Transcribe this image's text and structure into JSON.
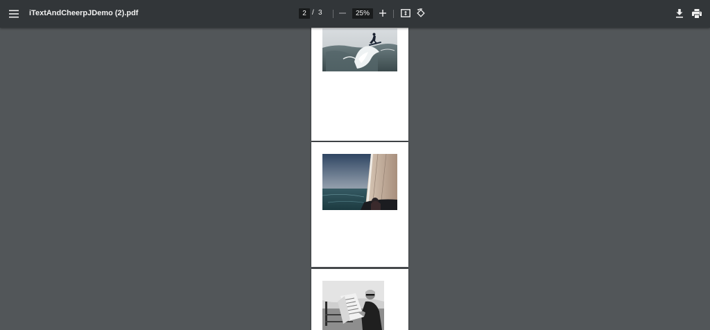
{
  "toolbar": {
    "menu_icon": "hamburger-menu-icon",
    "file_title": "iTextAndCheerpJDemo (2).pdf",
    "current_page": "2",
    "page_separator": "/",
    "total_pages": "3",
    "zoom_out_icon": "minus-icon",
    "zoom_level": "25%",
    "zoom_in_icon": "plus-icon",
    "fit_icon": "fit-to-page-icon",
    "rotate_icon": "rotate-icon",
    "download_icon": "download-icon",
    "print_icon": "print-icon"
  },
  "document": {
    "pages": [
      {
        "image": "surfer-photo"
      },
      {
        "image": "sailboat-photo"
      },
      {
        "image": "man-reading-newspaper-photo"
      }
    ]
  },
  "colors": {
    "toolbar_bg": "#323639",
    "viewer_bg": "#525659",
    "page_bg": "#ffffff",
    "input_bg": "#191b1c",
    "text": "#f1f1f1"
  }
}
